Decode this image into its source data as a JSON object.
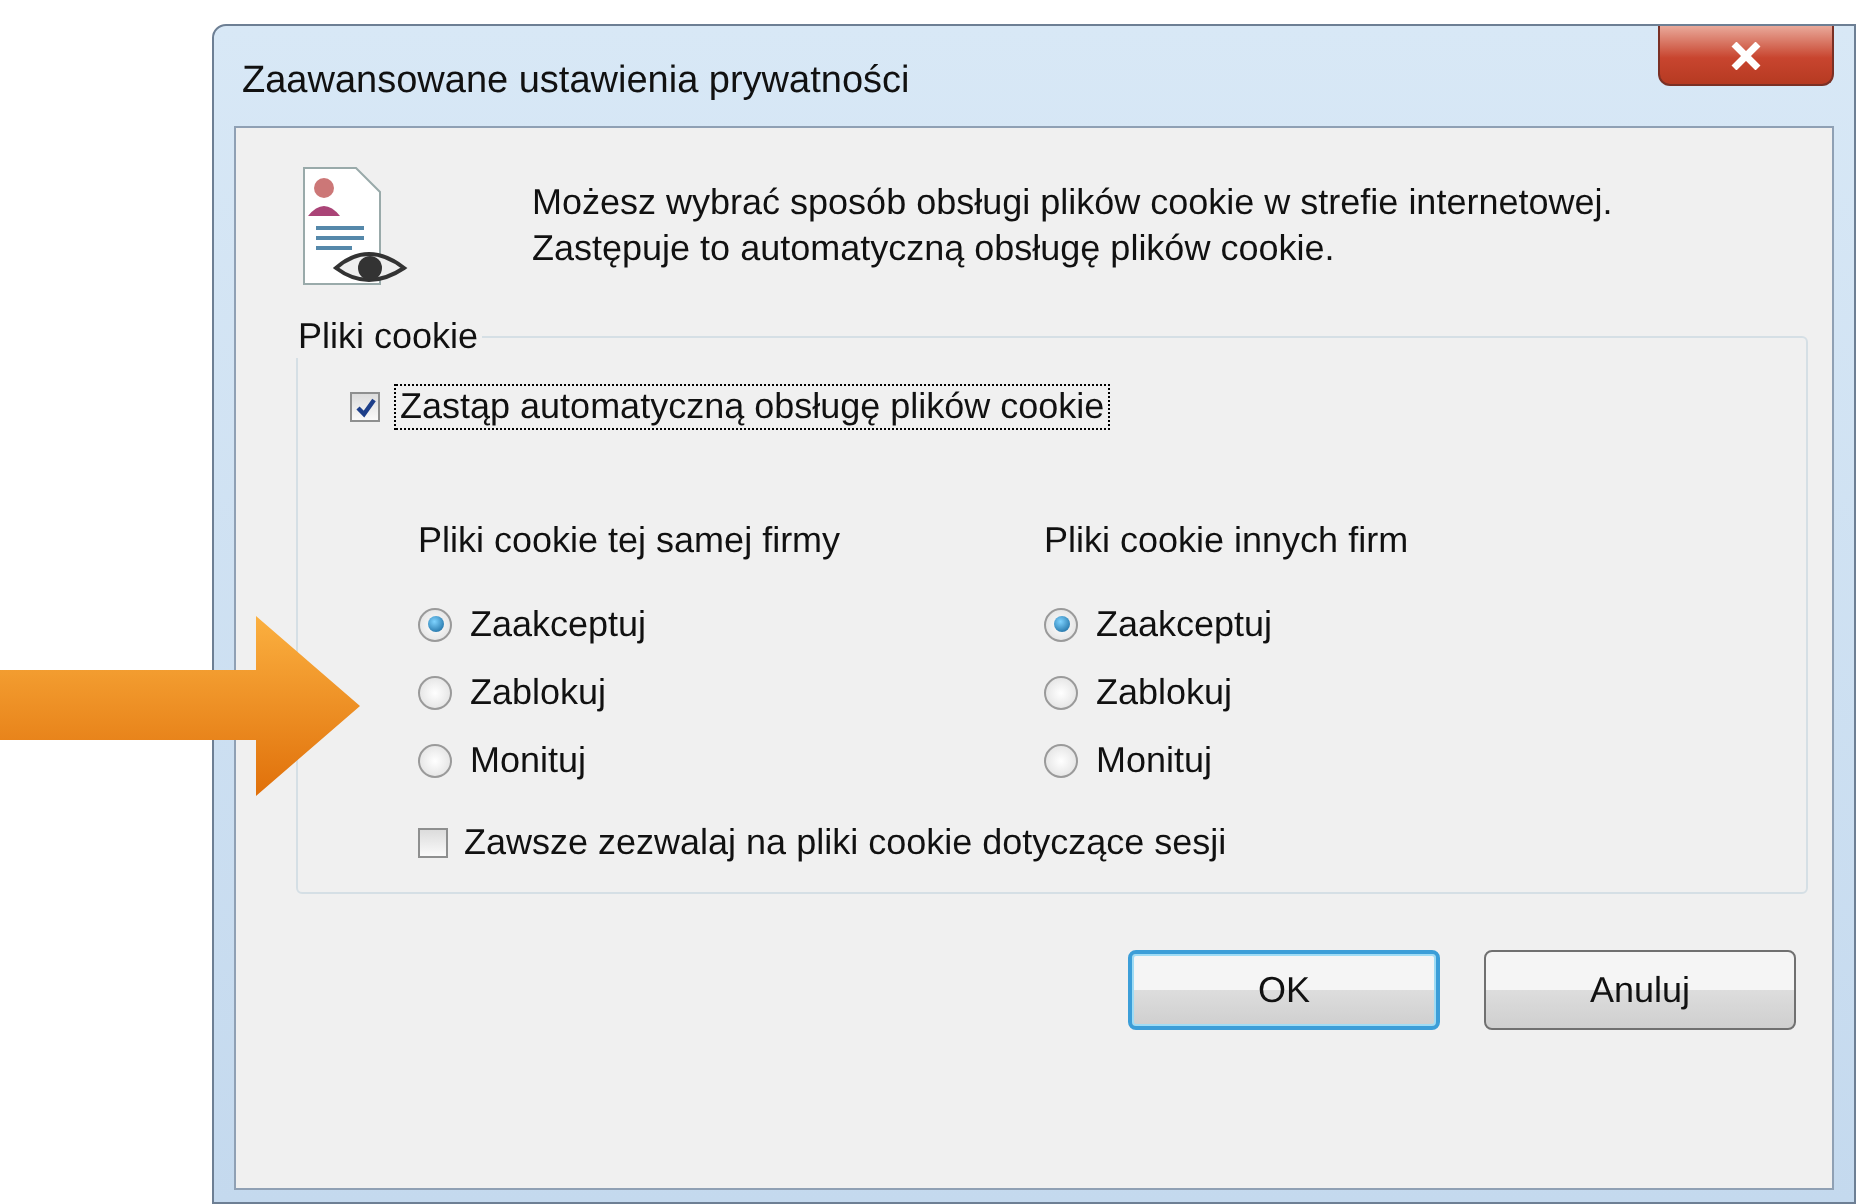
{
  "window": {
    "title": "Zaawansowane ustawienia prywatności"
  },
  "description": "Możesz wybrać sposób obsługi plików cookie w strefie internetowej. Zastępuje to automatyczną obsługę plików cookie.",
  "cookies_group": {
    "label": "Pliki cookie",
    "override": {
      "label": "Zastąp automatyczną obsługę plików cookie",
      "checked": true,
      "focused": true
    },
    "columns": [
      {
        "heading": "Pliki cookie tej samej firmy",
        "options": [
          {
            "label": "Zaakceptuj",
            "selected": true
          },
          {
            "label": "Zablokuj",
            "selected": false
          },
          {
            "label": "Monituj",
            "selected": false
          }
        ]
      },
      {
        "heading": "Pliki cookie innych firm",
        "options": [
          {
            "label": "Zaakceptuj",
            "selected": true
          },
          {
            "label": "Zablokuj",
            "selected": false
          },
          {
            "label": "Monituj",
            "selected": false
          }
        ]
      }
    ],
    "session": {
      "label": "Zawsze zezwalaj na pliki cookie dotyczące sesji",
      "checked": false
    }
  },
  "buttons": [
    {
      "label": "OK",
      "default": true
    },
    {
      "label": "Anuluj",
      "default": false
    }
  ]
}
